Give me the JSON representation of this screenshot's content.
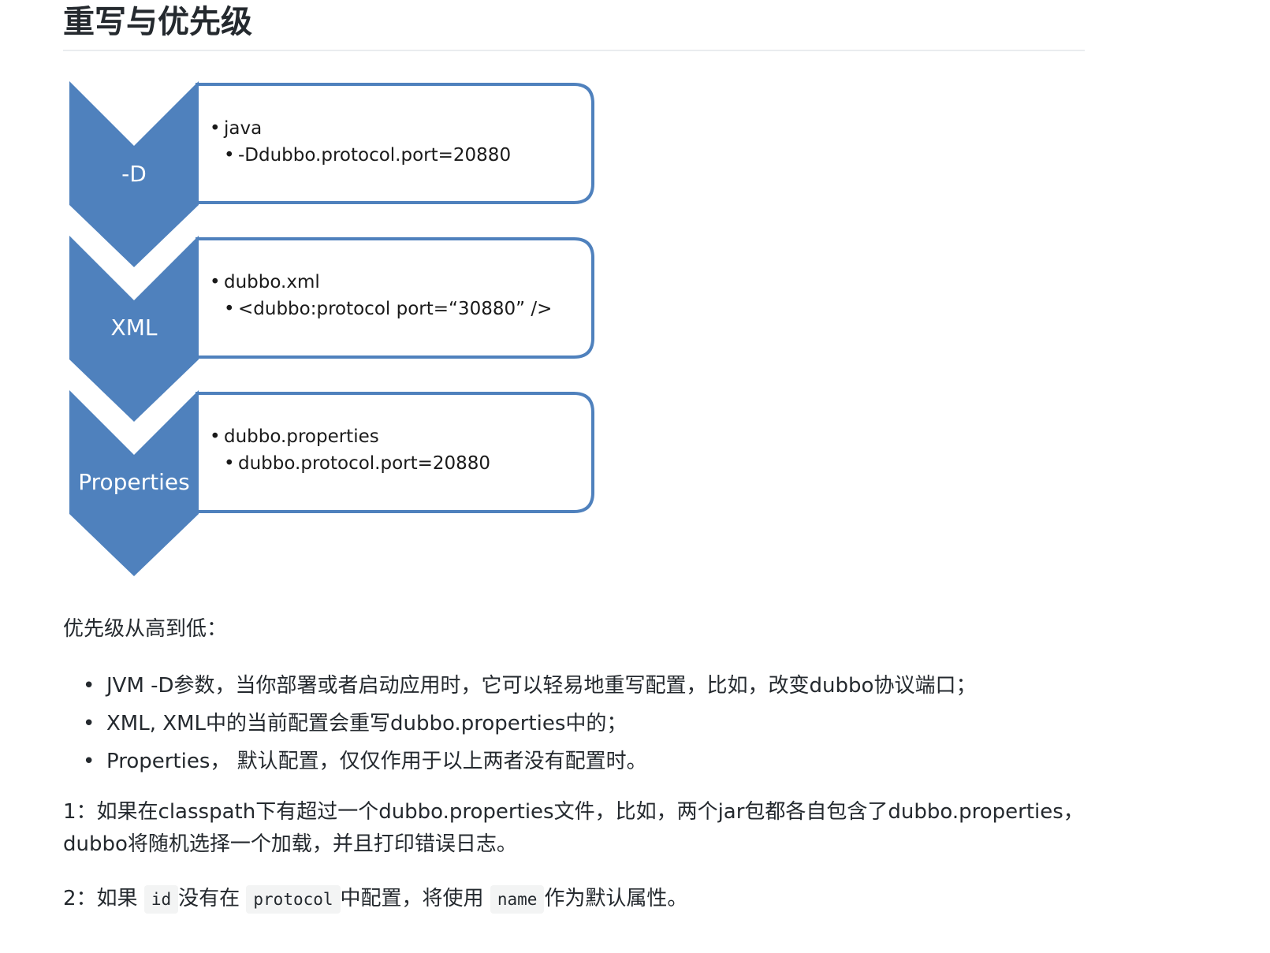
{
  "heading": "重写与优先级",
  "diagram": {
    "accent_color": "#4f81bd",
    "levels": [
      {
        "label": "-D",
        "item": "java",
        "sub_item": "-Ddubbo.protocol.port=20880"
      },
      {
        "label": "XML",
        "item": "dubbo.xml",
        "sub_item": "<dubbo:protocol port=“30880” />"
      },
      {
        "label": "Properties",
        "item": "dubbo.properties",
        "sub_item": "dubbo.protocol.port=20880"
      }
    ]
  },
  "priority_intro": "优先级从高到低：",
  "priority_list": [
    "JVM -D参数，当你部署或者启动应用时，它可以轻易地重写配置，比如，改变dubbo协议端口；",
    "XML, XML中的当前配置会重写dubbo.properties中的；",
    "Properties， 默认配置，仅仅作用于以上两者没有配置时。"
  ],
  "note1": {
    "line1": "1：如果在classpath下有超过一个dubbo.properties文件，比如，两个jar包都各自包含了dubbo.properties，",
    "line2": "dubbo将随机选择一个加载，并且打印错误日志。"
  },
  "note2": {
    "prefix": "2：如果",
    "code1": "id",
    "mid1": "没有在",
    "code2": "protocol",
    "mid2": "中配置，将使用",
    "code3": "name",
    "suffix": "作为默认属性。"
  }
}
